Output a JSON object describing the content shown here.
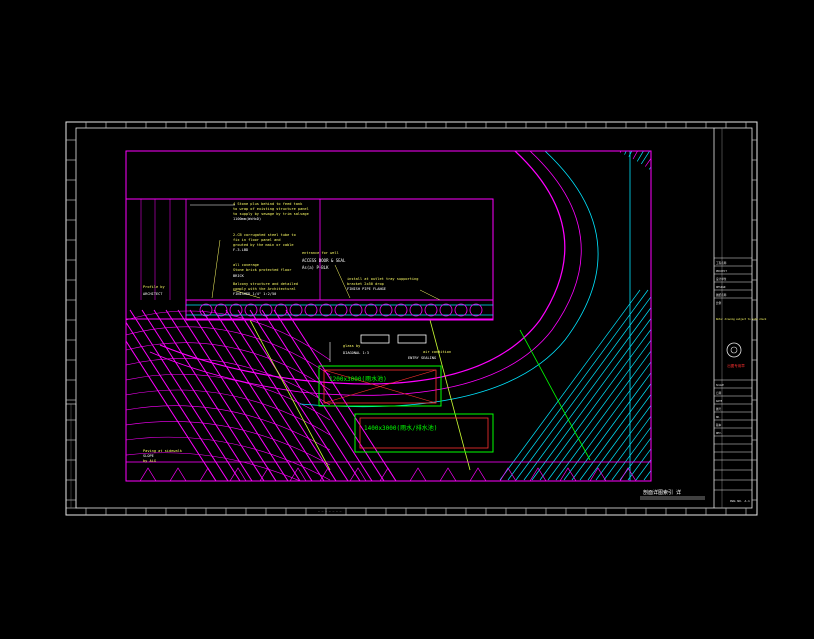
{
  "drawing": {
    "background": "#000000",
    "colors": {
      "frame": "#e8e8e8",
      "wall": "#ff00ff",
      "curve": "#00e5ff",
      "accent_green": "#00ff00",
      "label_yellow": "#ffff66",
      "label_red": "#ff3030",
      "note_white": "#ffffff"
    },
    "sheet_title": "剖面详图索引   详",
    "note_1": {
      "line1": "4 Stone plus behind to feed tank",
      "line2": "to wrap of existing structure panel",
      "line3": "to supply by sewage by trim salvage",
      "line4": "1100mm(WxHxD)"
    },
    "note_2": {
      "line1": "2-CB corrugated steel tube to",
      "line2": "fix in floor panel and",
      "line3": "grouted by the main or cable",
      "line4": "F-3-LBD"
    },
    "note_3": {
      "line1": "entrance for well",
      "line2": "ACCESS DOOR & SEAL",
      "line3": "As(a) P-BLK"
    },
    "note_4": {
      "line1": "all coverage",
      "line2": "Stone brick protected floor",
      "line3": "BRICK"
    },
    "note_5": {
      "line1": "Balcony structure and detailed",
      "line2": "comply with the Architectural",
      "line3": "FINISHED 1/4\" 1:2/50"
    },
    "note_6": {
      "line1": "install at outlet tray supporting",
      "line2": "bracket 2x50 drop",
      "line3": "FINISH PIPE FLANGE"
    },
    "note_7": {
      "line1": "Profile by",
      "line2": "ARCHITECT"
    },
    "note_8": {
      "line1": "glass by",
      "line2": "DIAGONAL 1:3"
    },
    "note_9": {
      "line1": "air condition",
      "line2": "ENTRY SEALING"
    },
    "note_10": {
      "line1": "Paving at sidewalk",
      "line2": "SLOPE",
      "line3": "by ALG"
    },
    "box_1_label": "1200x3000(雨水池)",
    "box_2_label": "1400x3000(雨水/排水池)",
    "title_block": {
      "cells": [
        "工程名称",
        "PROJECT",
        "设计单位",
        "DESIGN",
        "图纸名称",
        "比例",
        "SCALE",
        "日期",
        "DATE",
        "图号",
        "NO.",
        "版本",
        "REV."
      ],
      "stamp": "出图专用章",
      "sub_note": "Note: drawing subject to site check",
      "bottom_code": "DWG NO. A-1"
    },
    "ruler_label": "— — — — — — —"
  }
}
